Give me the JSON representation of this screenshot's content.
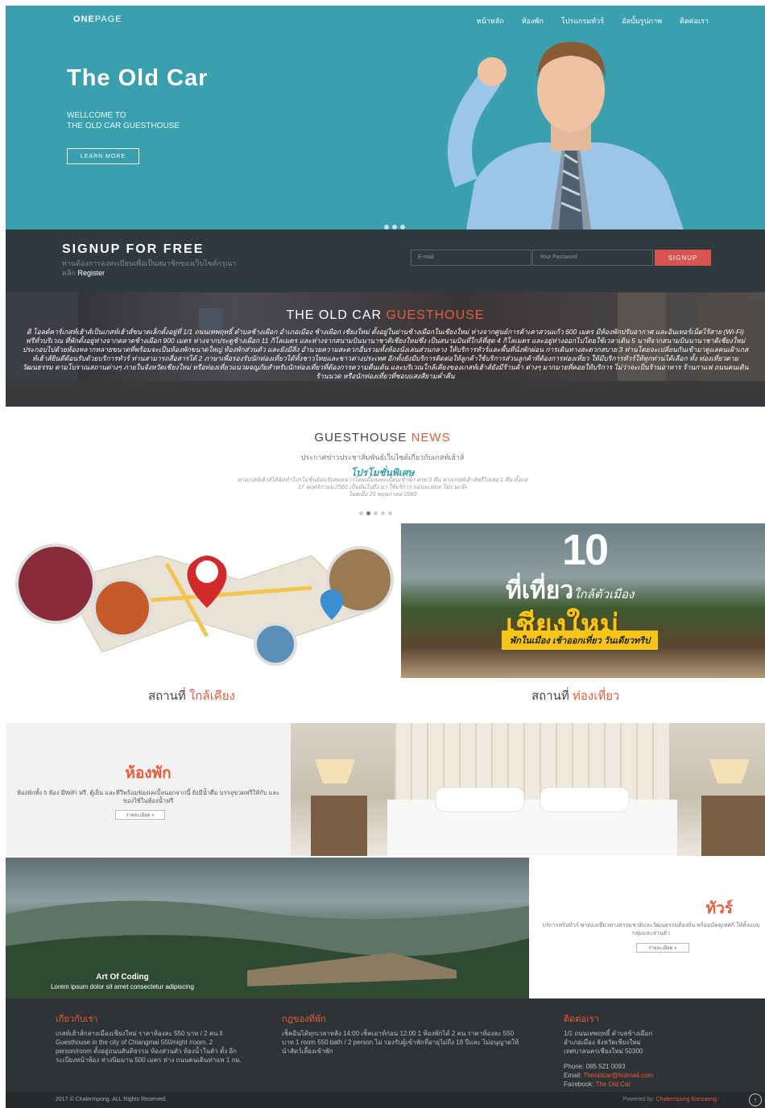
{
  "header": {
    "logo": "ONE",
    "logo_light": "PAGE",
    "nav": [
      "หน้าหลัก",
      "ห้องพัก",
      "โปรแกรมทัวร์",
      "อัลบั้มรูปภาพ",
      "ติดต่อเรา"
    ]
  },
  "hero": {
    "title": "The Old Car",
    "sub1": "WELLCOME TO",
    "sub2": "THE OLD CAR GUESTHOUSE",
    "button": "LEARN MORE"
  },
  "signup": {
    "title": "SIGNUP FOR FREE",
    "desc": "ท่านต้องการลงทะเบียนเพื่อเป็นสมาชิกของเว็บไซต์กรุณา",
    "desc2": "คลิก",
    "register": "Register",
    "email_placeholder": "E-mail",
    "password_placeholder": "Your Password",
    "button": "SIGNUP"
  },
  "banner": {
    "title": "THE OLD CAR",
    "title_accent": "GUESTHOUSE",
    "text": "ดิ โอลด์คาร์เกสท์เฮ้าส์เป็นเกสท์เฮ้าส์ขนาดเล็กตั้งอยู่ที่ 1/1 ถนนเทพฤทธิ์ ตำบลช้างเผือก อำเภอเมือง ช้างเผือก เชียงใหม่ ตั้งอยู่ในย่านช้างเผือกในเชียงใหม่ ห่างจากศูนย์การค้าเคาสวนแก้ว 600 เมตร มีห้องพักปรับอากาศ และอินเทอร์เน็ตไร้สาย (Wi-Fi) ฟรีทั่วบริเวณ ที่พักตั้งอยู่ห่างจากตลาดช้างเผือก 900 เมตร ห่างจากประตูช้างเผือก 11 กิโลเมตร และห่างจากสนามบินนานาชาติเชียงใหม่ซึ่ง เป็นสนามบินที่ใกล้ที่สุด 4 กิโลเมตร และอยู่ห่างออกไปโดยใช้เวลาเดิน 5 นาทีจากสนามบินนานาชาติเชียงใหม่ประกอบไปด้วยห้องหลากหลายขนาดที่พร้อมจะเป็นห้องพักขนาดใหญ่ ห้องพักส่วนตัว และยังมีสิ่ง อำนวยความสะดวกอื่นรวมทั้งห้องนั่งเล่นส่วนกลาง ให้บริการทัวร์และพื้นที่นั่งพักผ่อน การเดินทางสะดวกสบาย 3 ท่านโดยจะเปลี่ยนกันเข้ามาดูแลคนเฝ้าเกสท์เฮ้าส์ยินดีต้อนรับด้วยบริการทัวร์ ท่านสามารถสื่อสารได้ 2 ภาษาเพื่อรองรับนักท่องเที่ยวได้ทั้งชาวไทยและชาวต่างประเทศ อีกทั้งยังมีบริการติดต่อให้ลูกค้าใช้บริการส่วนลูกค้าที่ต้องการท่องเที่ยว ให้มีบริการทัวร์ให้ทุกท่านได้เลือก ทั้ง ท่องเที่ยวตามวัฒนธรรม ตามโบราณสถานต่างๆ ภายในจังหวัดเชียงใหม่ หรือท่องเที่ยวแนวผจญภัยสำหรับนักท่องเที่ยวที่ต้องการความตื่นเต้น และบริเวณใกล้เคียงของเกสท์เฮ้าส์ยังมีร้านค้า ต่างๆ มากมายที่คอยให้บริการ ไม่ว่าจะเป็นร้านอาหาร ร้านกาแฟ ถนนคนเดิน ร้านนวด หรือนักท่องเที่ยวที่ชอบแสงสียามค่ำคืน"
  },
  "news": {
    "title": "GUESTHOUSE",
    "title_accent": "NEWS",
    "sub": "ประกาศข่าวประชาสัมพันธ์เว็บไซต์เกี่ยวกับเกสท์เฮ้าส์",
    "headline": "โปรโมชั่นพิเศษ",
    "body1": "ทางเกสท์เฮ้าส์ได้จัดทำโปรโมชั่นต้อนรับลมหนาวโดยเมื่อลงทะเบียนเข้าพัก ครบ 3 คืน ทางเกสท์เฮ้าส์ฟรีไปเลย 1 คืน ตั้งแต่",
    "body2": "17 พฤศจิกายน 2560 เป็นต้นไปถึง มา ใช้บริการ ก่อนจะหมด โปร นะจ๊ะ",
    "body3": "โพสเมื่อ 23 พฤษภาคม 2560"
  },
  "places": {
    "banner_num": "10",
    "banner_line1": "ที่เที่ยว",
    "banner_line1_small": "ใกล้ตัวเมือง",
    "banner_line2": "เชียงใหม่",
    "banner_band": "พักในเมือง เช้าออกเที่ยว วันเดียวทริป",
    "left_label": "สถานที่",
    "left_accent": "ใกล้เคียง",
    "right_label": "สถานที่",
    "right_accent": "ท่องเที่ยว"
  },
  "room": {
    "title": "ห้องพัก",
    "desc": "ห้องพักทั้ง 5 ห้อง มีWiFi ฟรี, ตู้เย็น และทีวีพร้อมช่องเคเบิ้ลนอกจากนี้ ยังมีน้ำดื่ม บรรจุขวดฟรีให้กับ และของใช้ในห้องน้ำฟรี",
    "button": "รายละเอียด »"
  },
  "tour": {
    "caption_title": "Art Of Coding",
    "caption_text": "Lorem ipsum dolor sit amet consectetur adipiscing",
    "title": "ทัวร์",
    "desc": "บริการทริปทัวร์ พาท่องเที่ยวทางธรรมชาติและวัฒนธรรมท้องถิ่น พร้อมมัคคุเทศก์ ให้ทั้งแบบกลุ่มและส่วนตัว",
    "button": "รายละเอียด »"
  },
  "footer": {
    "about_title": "เกี่ยวกับเรา",
    "about_text": "เกสท์เฮ้าส์กลางเมืองเชียงใหม่ ราคาห้องละ 550 บาท / 2 คน ll Guesthouse in the city of Chiangmai 550/night /room, 2 person/room ตั้งอยู่ถนนสันติธรรม ห้องส่วนตัว ห้องน้ำในตัว ตั้ง อีกระเบียงหน้าห้อง ห่างนิมมาน 500 เมตร ห่าง ถนนคนเดินท่าแพ 1 กม.",
    "rules_title": "กฎของที่พัก",
    "rules_text": "เช็คอินได้ทุกเวลาหลัง 14:00 เช็คเอาท์ก่อน 12:00 1 ห้องพักได้ 2 คน ราคาห้องละ 550 บาท 1 room 550 bath / 2 person ไม่ รองรับผู้เข้าพักที่อายุไม่ถึง 18 ปีและ ไม่อนุญาตให้นำสัตว์เลี้ยงเข้าพัก",
    "contact_title": "ติดต่อเรา",
    "contact_addr1": "1/1 ถนนเทพฤทธิ์ ตำบลช้างเผือก",
    "contact_addr2": "อำเภอเมือง จังหวัดเชียงใหม่",
    "contact_addr3": "เทศบาลนครเชียงใหม่ 50300",
    "phone": "Phone: 085 521 0093",
    "email_label": "Email:",
    "email": "Theoldcar@hotmail.com",
    "fb_label": "Facebook:",
    "fb": "The Old Car"
  },
  "copyright": {
    "left": "2017 © Chalermpong. ALL Rights Reserved.",
    "right_label": "Powered by:",
    "right_name": "Chalermpong Konsaeng"
  },
  "colors": {
    "accent": "#e95b3a",
    "hero": "#3a9fae",
    "dark": "#2e3a40"
  }
}
